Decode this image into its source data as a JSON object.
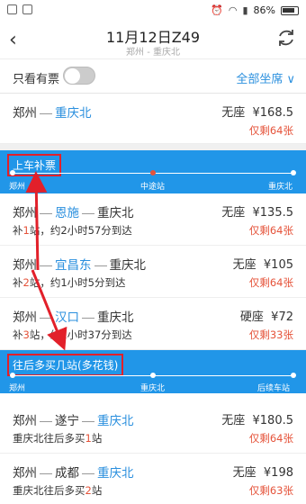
{
  "status_bar": {
    "battery": "86%"
  },
  "header": {
    "title": "11月12日Z49",
    "subtitle": "郑州 - 重庆北"
  },
  "filter": {
    "only_tickets_label": "只看有票",
    "seat_filter": "全部坐席 ∨"
  },
  "direct": {
    "from": "郑州",
    "to": "重庆北",
    "seat": "无座",
    "price": "¥168.5",
    "remain": "仅剩64张"
  },
  "band1": {
    "title": "上车补票",
    "labels": [
      "郑州",
      "中途站",
      "重庆北"
    ]
  },
  "routes1": [
    {
      "from": "郑州",
      "mid": "恩施",
      "to": "重庆北",
      "seat": "无座",
      "price": "¥135.5",
      "remain": "仅剩64张",
      "note_a": "补",
      "note_b": "1",
      "note_c": "站，约2小时57分到达"
    },
    {
      "from": "郑州",
      "mid": "宜昌东",
      "to": "重庆北",
      "seat": "无座",
      "price": "¥105",
      "remain": "仅剩64张",
      "note_a": "补",
      "note_b": "2",
      "note_c": "站，约1小时5分到达"
    },
    {
      "from": "郑州",
      "mid": "汉口",
      "to": "重庆北",
      "seat": "硬座",
      "price": "¥72",
      "remain": "仅剩33张",
      "note_a": "补",
      "note_b": "3",
      "note_c": "站，约2小时37分到达"
    }
  ],
  "band2": {
    "title": "往后多买几站(多花钱)",
    "labels": [
      "郑州",
      "重庆北",
      "后续车站"
    ]
  },
  "routes2": [
    {
      "from": "郑州",
      "mid": "遂宁",
      "to": "重庆北",
      "seat": "无座",
      "price": "¥180.5",
      "remain": "仅剩64张",
      "note_a": "重庆北往后多买",
      "note_b": "1",
      "note_c": "站"
    },
    {
      "from": "郑州",
      "mid": "成都",
      "to": "重庆北",
      "seat": "无座",
      "price": "¥198",
      "remain": "仅剩63张",
      "note_a": "重庆北往后多买",
      "note_b": "2",
      "note_c": "站"
    }
  ],
  "colors": {
    "accent": "#2196e8",
    "link": "#2a8fde",
    "warn": "#e5533a",
    "annotation": "#e2202a"
  }
}
